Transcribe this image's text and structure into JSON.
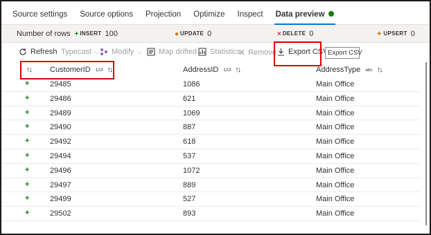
{
  "tabs": [
    {
      "label": "Source settings",
      "active": false
    },
    {
      "label": "Source options",
      "active": false
    },
    {
      "label": "Projection",
      "active": false
    },
    {
      "label": "Optimize",
      "active": false
    },
    {
      "label": "Inspect",
      "active": false
    },
    {
      "label": "Data preview",
      "active": true,
      "status_color": "#107c10"
    }
  ],
  "counts": {
    "rows_label": "Number of rows",
    "insert": {
      "tag": "INSERT",
      "value": "100",
      "icon": "plus-icon"
    },
    "update": {
      "tag": "UPDATE",
      "value": "0",
      "icon": "update-dot-icon"
    },
    "delete": {
      "tag": "DELETE",
      "value": "0",
      "icon": "delete-x-icon"
    },
    "upsert": {
      "tag": "UPSERT",
      "value": "0",
      "icon": "upsert-icon"
    }
  },
  "toolbar": {
    "refresh": "Refresh",
    "typecast": "Typecast",
    "modify": "Modify",
    "map_drifted": "Map drifted",
    "statistics": "Statistics",
    "remove": "Remove",
    "export_csv": "Export CSV",
    "tooltip": "Export CSV"
  },
  "table": {
    "columns": [
      {
        "name": "CustomerID",
        "type": "123"
      },
      {
        "name": "AddressID",
        "type": "123"
      },
      {
        "name": "AddressType",
        "type": "abc"
      }
    ],
    "rows": [
      [
        "29485",
        "1086",
        "Main Office"
      ],
      [
        "29486",
        "621",
        "Main Office"
      ],
      [
        "29489",
        "1069",
        "Main Office"
      ],
      [
        "29490",
        "887",
        "Main Office"
      ],
      [
        "29492",
        "618",
        "Main Office"
      ],
      [
        "29494",
        "537",
        "Main Office"
      ],
      [
        "29496",
        "1072",
        "Main Office"
      ],
      [
        "29497",
        "889",
        "Main Office"
      ],
      [
        "29499",
        "527",
        "Main Office"
      ],
      [
        "29502",
        "893",
        "Main Office"
      ]
    ]
  },
  "colors": {
    "accent": "#0078d4",
    "insert": "#107c10",
    "highlight": "#e00000"
  }
}
